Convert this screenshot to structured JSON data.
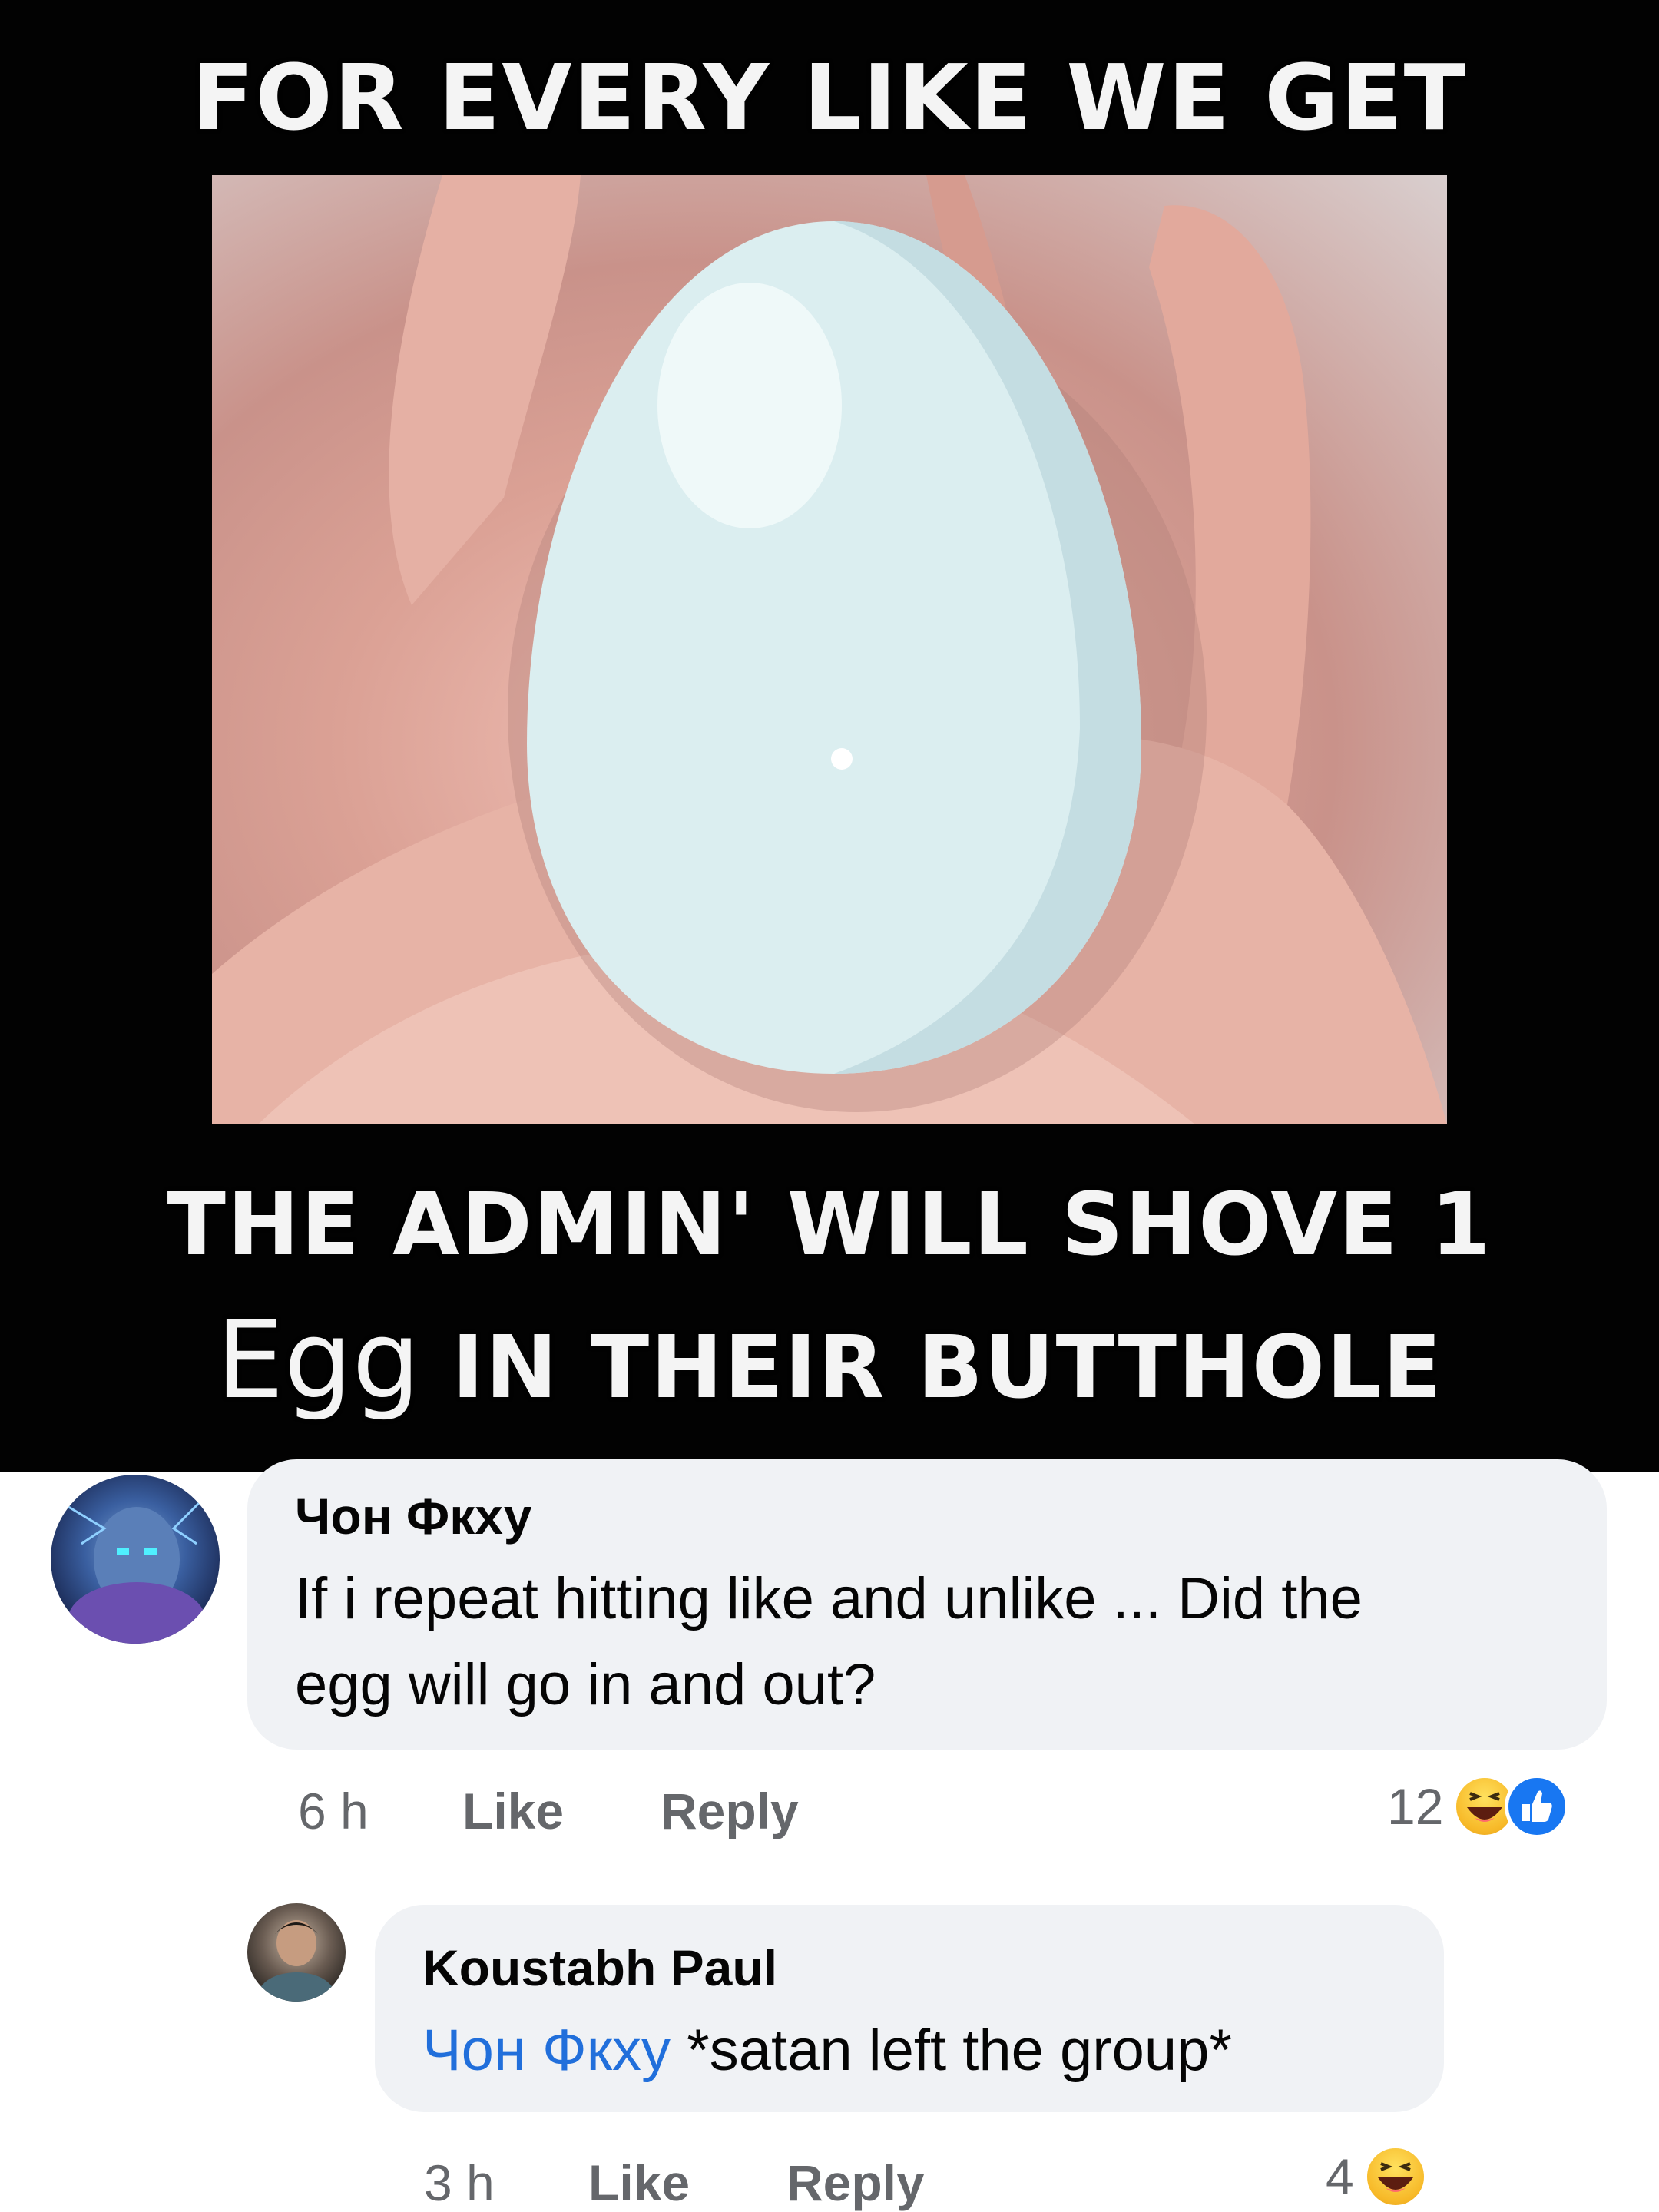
{
  "meme": {
    "caption_top": "FOR EVERY LIKE WE GET",
    "caption_mid": "THE ADMIN' WILL SHOVE 1",
    "caption_bot_egg": "Egg",
    "caption_bot_rest": " IN THEIR BUTTHOLE"
  },
  "comments": [
    {
      "author": "Чон Фкху",
      "line1": "If i repeat hitting like and unlike ... Did the",
      "line2": "egg will go in and out?",
      "time": "6 h",
      "like_label": "Like",
      "reply_label": "Reply",
      "reaction_count": "12",
      "reaction_icons": [
        "haha-icon",
        "like-icon"
      ]
    },
    {
      "author": "Koustabh Paul",
      "mention": "Чон Фкху",
      "text": " *satan left the group*",
      "time": "3 h",
      "like_label": "Like",
      "reply_label": "Reply",
      "reaction_count": "4",
      "reaction_icons": [
        "haha-icon"
      ]
    }
  ],
  "colors": {
    "bubble": "#f0f2f5",
    "mention": "#216fdb",
    "meta": "#65676b",
    "like_blue": "#1877f2",
    "haha_yellow": "#f7b928"
  }
}
